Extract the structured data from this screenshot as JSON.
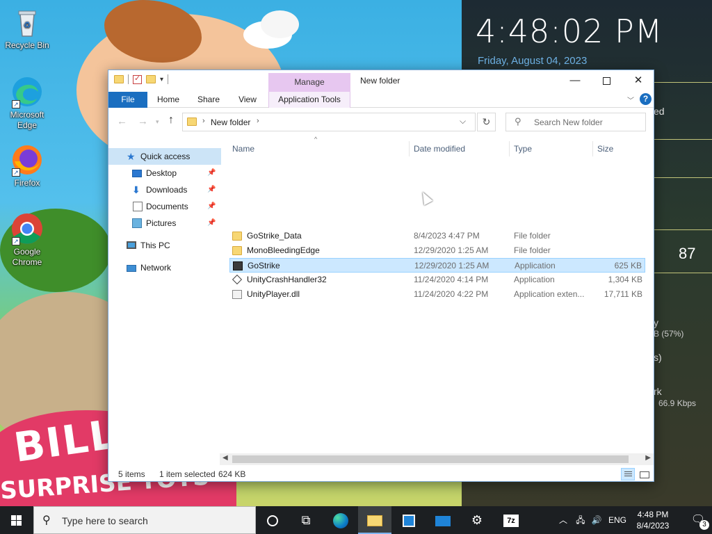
{
  "desktop": {
    "icons": [
      {
        "label": "Recycle Bin",
        "icon": "recycle-bin-icon"
      },
      {
        "label": "Microsoft Edge",
        "icon": "edge-icon"
      },
      {
        "label": "Firefox",
        "icon": "firefox-icon"
      },
      {
        "label": "Google Chrome",
        "icon": "chrome-icon"
      }
    ],
    "wallpaper_text": {
      "line1": "BILL",
      "line2": "SURPRISE TOYS"
    }
  },
  "widget": {
    "clock": "4:48:02 PM",
    "date": "Friday, August 04, 2023",
    "frag_ed": "ed",
    "frag_87": "87",
    "frag_y": "y",
    "frag_pct": "B (57%)",
    "frag_s": "s)",
    "frag_rk": "rk",
    "frag_kbps": "66.9 Kbps"
  },
  "explorer": {
    "title": "New folder",
    "manage_tab": "Manage",
    "ribbon_tabs": {
      "file": "File",
      "home": "Home",
      "share": "Share",
      "view": "View",
      "app_tools": "Application Tools"
    },
    "address": {
      "folder": "New folder"
    },
    "search": {
      "placeholder": "Search New folder"
    },
    "nav": {
      "quick_access": "Quick access",
      "desktop": "Desktop",
      "downloads": "Downloads",
      "documents": "Documents",
      "pictures": "Pictures",
      "this_pc": "This PC",
      "network": "Network"
    },
    "columns": {
      "name": "Name",
      "date": "Date modified",
      "type": "Type",
      "size": "Size"
    },
    "files": [
      {
        "name": "GoStrike_Data",
        "date": "8/4/2023 4:47 PM",
        "type": "File folder",
        "size": "",
        "icon": "folder-icon"
      },
      {
        "name": "MonoBleedingEdge",
        "date": "12/29/2020 1:25 AM",
        "type": "File folder",
        "size": "",
        "icon": "folder-icon"
      },
      {
        "name": "GoStrike",
        "date": "12/29/2020 1:25 AM",
        "type": "Application",
        "size": "625 KB",
        "icon": "app-icon",
        "selected": true
      },
      {
        "name": "UnityCrashHandler32",
        "date": "11/24/2020 4:14 PM",
        "type": "Application",
        "size": "1,304 KB",
        "icon": "unity-icon"
      },
      {
        "name": "UnityPlayer.dll",
        "date": "11/24/2020 4:22 PM",
        "type": "Application exten...",
        "size": "17,711 KB",
        "icon": "dll-icon"
      }
    ],
    "status": {
      "items": "5 items",
      "selected": "1 item selected",
      "size": "624 KB"
    }
  },
  "taskbar": {
    "search_placeholder": "Type here to search",
    "language": "ENG",
    "time": "4:48 PM",
    "date": "8/4/2023",
    "notifications": "3"
  }
}
